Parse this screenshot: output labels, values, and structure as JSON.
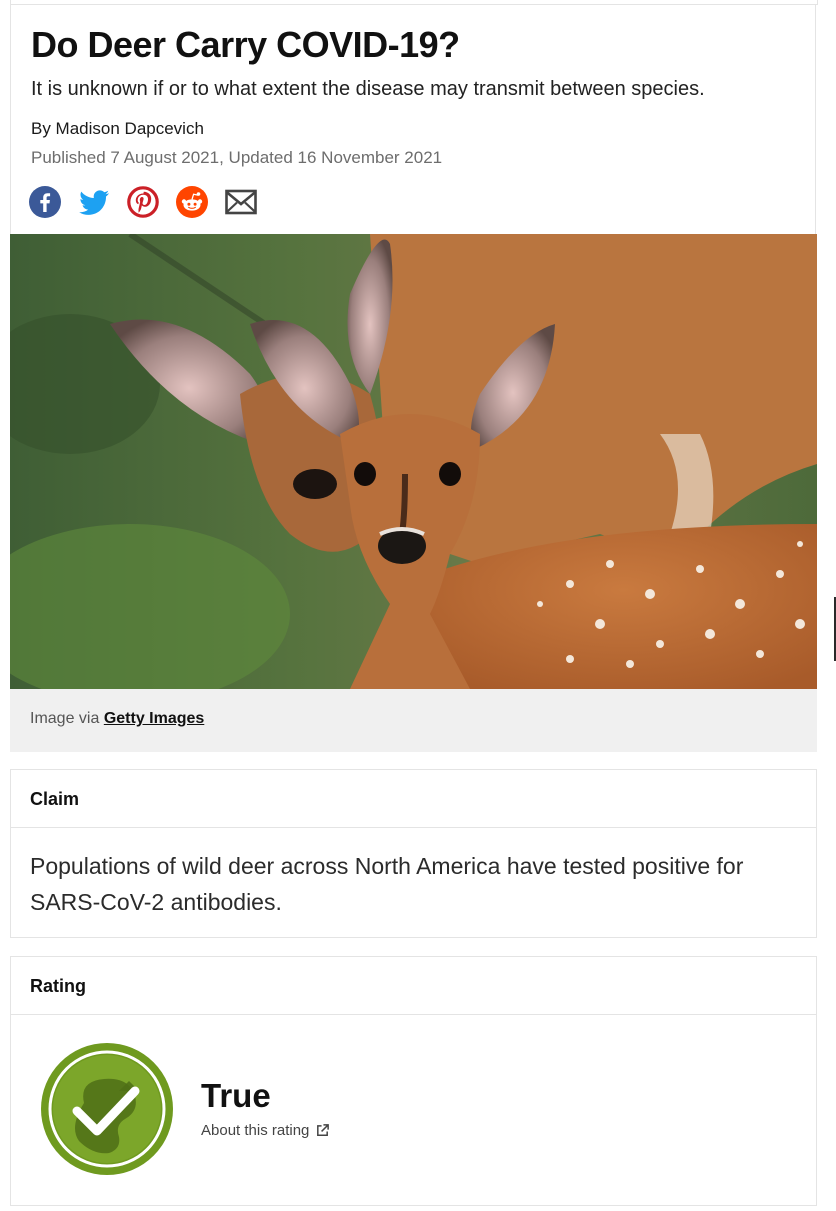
{
  "article": {
    "title": "Do Deer Carry COVID-19?",
    "subtitle": "It is unknown if or to what extent the disease may transmit between species.",
    "byline": "By Madison Dapcevich",
    "dates": "Published 7 August 2021,  Updated 16 November 2021"
  },
  "share": {
    "icons": [
      "facebook-icon",
      "twitter-icon",
      "pinterest-icon",
      "reddit-icon",
      "email-icon"
    ],
    "colors": {
      "facebook": "#3b5998",
      "twitter": "#1da1f2",
      "pinterest": "#cb2027",
      "reddit": "#ff4500",
      "email": "#444444"
    }
  },
  "hero": {
    "caption_prefix": "Image via ",
    "caption_link": "Getty Images"
  },
  "claim": {
    "heading": "Claim",
    "text": "Populations of wild deer across North America have tested positive for SARS-CoV-2 antibodies."
  },
  "rating": {
    "heading": "Rating",
    "verdict": "True",
    "about_label": "About this rating",
    "badge_color": "#6f9a1f"
  }
}
